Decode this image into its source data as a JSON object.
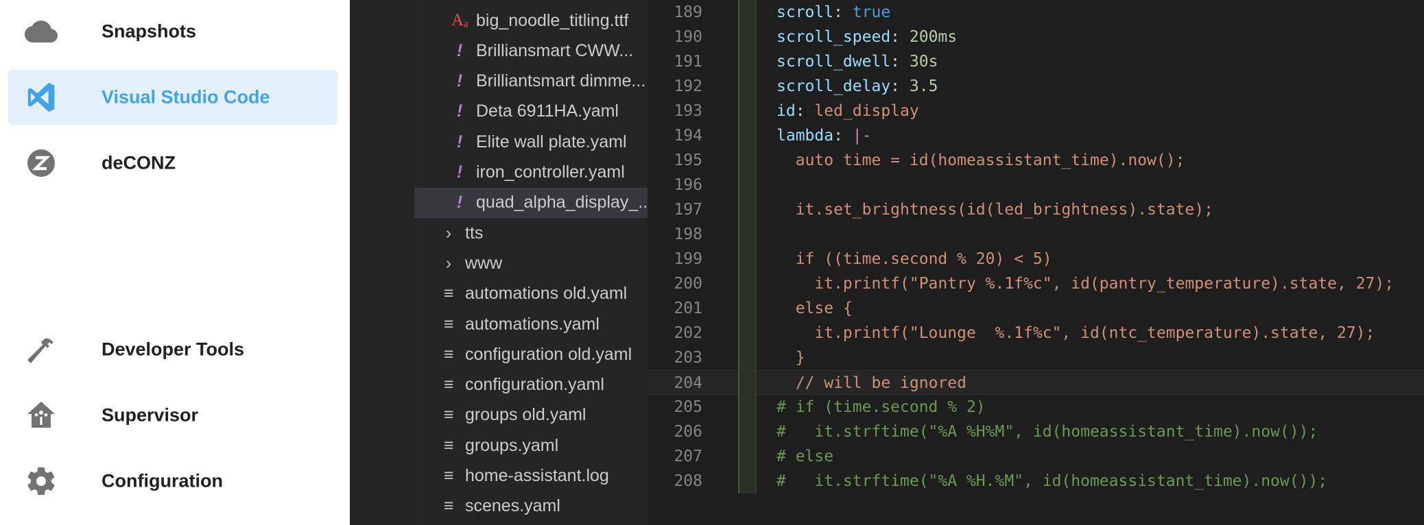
{
  "sidebar": {
    "items": [
      {
        "label": "Snapshots",
        "icon": "cloud-icon",
        "active": false
      },
      {
        "label": "Visual Studio Code",
        "icon": "vscode-icon",
        "active": true
      },
      {
        "label": "deCONZ",
        "icon": "deconz-icon",
        "active": false
      },
      {
        "label": "Developer Tools",
        "icon": "hammer-icon",
        "active": false
      },
      {
        "label": "Supervisor",
        "icon": "supervisor-icon",
        "active": false
      },
      {
        "label": "Configuration",
        "icon": "gear-icon",
        "active": false
      }
    ],
    "colors": {
      "active_text": "#41a4e6",
      "active_bg": "#e3f0fb",
      "text": "#212121",
      "icon": "#727272"
    }
  },
  "explorer": {
    "items": [
      {
        "label": "big_noodle_titling.ttf",
        "type": "font"
      },
      {
        "label": "Brilliansmart CWW...",
        "type": "yaml"
      },
      {
        "label": "Brilliantsmart dimme...",
        "type": "yaml"
      },
      {
        "label": "Deta 6911HA.yaml",
        "type": "yaml"
      },
      {
        "label": "Elite wall plate.yaml",
        "type": "yaml"
      },
      {
        "label": "iron_controller.yaml",
        "type": "yaml"
      },
      {
        "label": "quad_alpha_display_...",
        "type": "yaml",
        "selected": true
      },
      {
        "label": "tts",
        "type": "folder"
      },
      {
        "label": "www",
        "type": "folder"
      },
      {
        "label": "automations old.yaml",
        "type": "text"
      },
      {
        "label": "automations.yaml",
        "type": "text"
      },
      {
        "label": "configuration old.yaml",
        "type": "text"
      },
      {
        "label": "configuration.yaml",
        "type": "text"
      },
      {
        "label": "groups old.yaml",
        "type": "text"
      },
      {
        "label": "groups.yaml",
        "type": "text"
      },
      {
        "label": "home-assistant.log",
        "type": "text"
      },
      {
        "label": "scenes.yaml",
        "type": "text"
      }
    ]
  },
  "editor": {
    "lines": [
      {
        "num": "189",
        "text": "scroll: true"
      },
      {
        "num": "190",
        "text": "scroll_speed: 200ms"
      },
      {
        "num": "191",
        "text": "scroll_dwell: 30s"
      },
      {
        "num": "192",
        "text": "scroll_delay: 3.5"
      },
      {
        "num": "193",
        "text": "id: led_display"
      },
      {
        "num": "194",
        "text": "lambda: |-"
      },
      {
        "num": "195",
        "text": "  auto time = id(homeassistant_time).now();"
      },
      {
        "num": "196",
        "text": ""
      },
      {
        "num": "197",
        "text": "  it.set_brightness(id(led_brightness).state);"
      },
      {
        "num": "198",
        "text": ""
      },
      {
        "num": "199",
        "text": "  if ((time.second % 20) < 5)"
      },
      {
        "num": "200",
        "text": "    it.printf(\"Pantry %.1f%c\", id(pantry_temperature).state, 27);"
      },
      {
        "num": "201",
        "text": "  else {"
      },
      {
        "num": "202",
        "text": "    it.printf(\"Lounge  %.1f%c\", id(ntc_temperature).state, 27);"
      },
      {
        "num": "203",
        "text": "  }"
      },
      {
        "num": "204",
        "text": "  // will be ignored"
      },
      {
        "num": "205",
        "text": "# if (time.second % 2)"
      },
      {
        "num": "206",
        "text": "#   it.strftime(\"%A %H%M\", id(homeassistant_time).now());"
      },
      {
        "num": "207",
        "text": "# else"
      },
      {
        "num": "208",
        "text": "#   it.strftime(\"%A %H.%M\", id(homeassistant_time).now());"
      }
    ],
    "current_line": "204",
    "colors": {
      "key": "#9cdcfe",
      "number": "#b5cea8",
      "boolean": "#569cd6",
      "string": "#ce9178",
      "comment": "#6a9955",
      "line_number": "#858585"
    }
  }
}
